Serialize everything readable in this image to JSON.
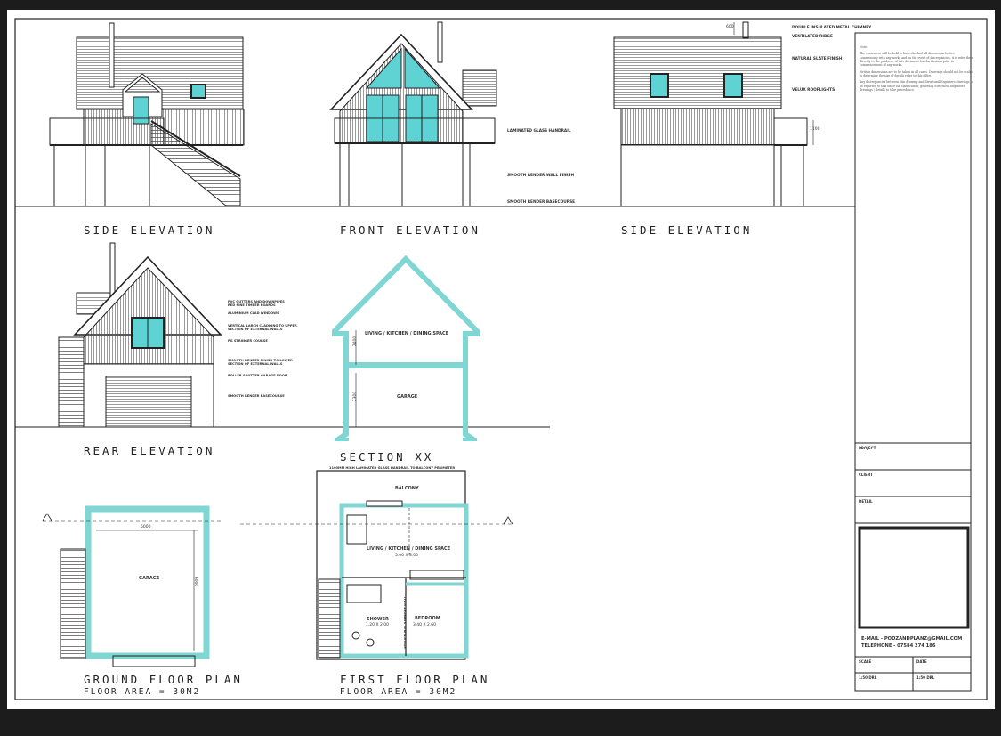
{
  "titles": {
    "side_elevation_left": "SIDE ELEVATION",
    "front_elevation": "FRONT ELEVATION",
    "side_elevation_right": "SIDE ELEVATION",
    "rear_elevation": "REAR ELEVATION",
    "section": "SECTION XX",
    "ground_plan": "GROUND FLOOR PLAN",
    "ground_area": "FLOOR AREA = 30M2",
    "first_plan": "FIRST FLOOR PLAN",
    "first_area": "FLOOR AREA = 30M2"
  },
  "front_notes": {
    "handrail": "LAMINATED GLASS HANDRAIL",
    "render_wall": "SMOOTH RENDER WALL FINISH",
    "render_base": "SMOOTH RENDER BASECOURSE"
  },
  "side_notes": {
    "chimney": "DOUBLE INSULATED METAL CHIMNEY",
    "ridge": "VENTILATED RIDGE",
    "slate": "NATURAL SLATE FINISH",
    "rooflights": "VELUX ROOFLIGHTS",
    "handrail_dim": "1100",
    "chimney_dim": "600"
  },
  "rear_notes": {
    "gutters": "PVC GUTTERS AND DOWNPIPES",
    "fascias": "RED PINE TIMBER BOARDS",
    "windows": "ALUMINIUM CLAD WINDOWS",
    "cladding1": "VERTICAL LARCH CLADDING TO UPPER",
    "cladding2": "SECTION OF EXTERNAL WALLS",
    "stringer": "PG STRINGER COURSE",
    "render1": "SMOOTH RENDER FINISH TO LOWER",
    "render2": "SECTION OF EXTERNAL WALLS",
    "garage_door": "ROLLER SHUTTER GARAGE DOOR",
    "basecourse": "SMOOTH RENDER BASECOURSE"
  },
  "section": {
    "upper_room": "LIVING / KITCHEN / DINING SPACE",
    "lower_room": "GARAGE",
    "upper_dim": "2400",
    "lower_dim": "2300"
  },
  "ground_plan": {
    "room": "GARAGE",
    "width_dim": "5000",
    "depth_dim": "6000"
  },
  "first_plan": {
    "handrail_note": "1100MM HIGH LAMINATED GLASS HANDRAIL TO BALCONY PERIMETER",
    "balcony": "BALCONY",
    "living": "LIVING / KITCHEN / DINING SPACE",
    "living_dim": "5.00 X 3.00",
    "shower": "SHOWER",
    "shower_dim": "1.20 X 2.00",
    "bedroom": "BEDROOM",
    "bedroom_dim": "3.40 X 2.60",
    "partition": "STRUCTURAL SUPPORT WALL"
  },
  "title_block": {
    "notes_heading": "Note:",
    "note1": "The contractor will be held to have checked all dimensions before commencing with any works and on the event of discrepancies, it is refer them directly to the producer of this document for clarification prior to commencement of any works.",
    "note2": "Written dimensions are to be taken in all cases. Drawings should not be scaled to determine the size of details refer to this office.",
    "note3": "Any discrepancies between this drawing and Structural Engineers drawings to be reported to this office for clarification, generally Structural Engineers drawings / details to take precedence.",
    "project_label": "PROJECT",
    "client_label": "CLIENT",
    "detail_label": "DETAIL",
    "email": "E-MAIL - PODZANDPLANZ@GMAIL.COM",
    "phone": "TELEPHONE - 07584 274 186",
    "scale_label": "SCALE",
    "date_label": "DATE",
    "scale_value": "1:50 DRL",
    "date_value": "1:50 DRL"
  },
  "colors": {
    "glazing": "#5fd3d3",
    "wall": "#7fd6d2",
    "line": "#222222"
  }
}
